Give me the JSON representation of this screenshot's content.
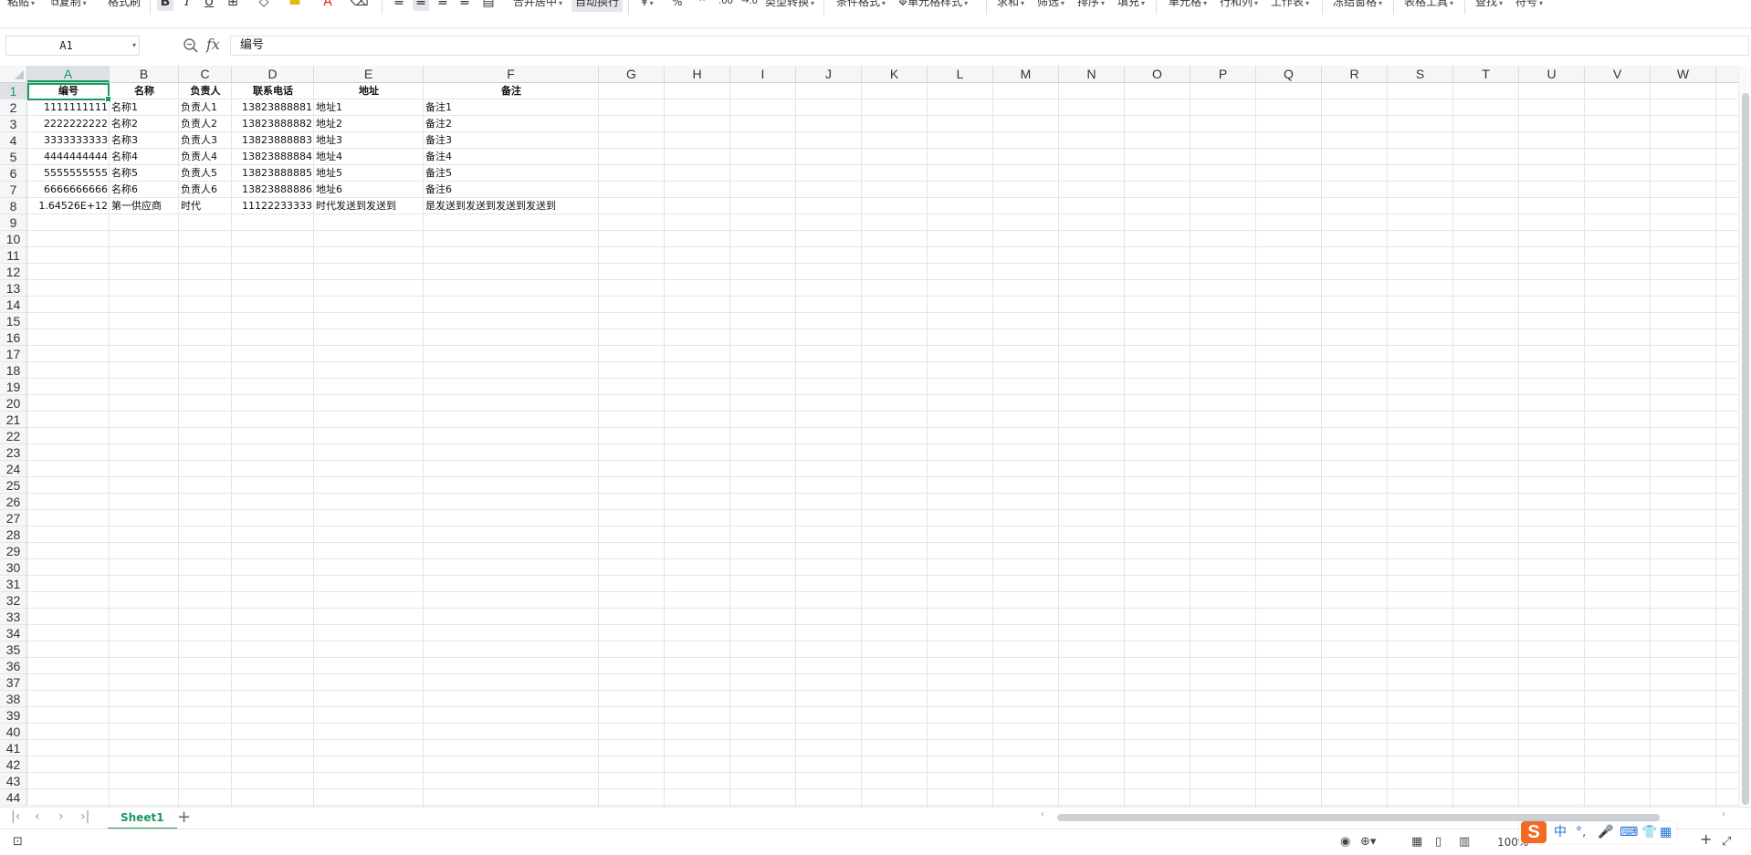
{
  "ribbon": {
    "paste": "粘贴",
    "copy": "复制",
    "format_painter": "格式刷",
    "merge_center": "合并居中",
    "wrap_text": "自动换行",
    "currency": "¥",
    "percent": "%",
    "type_convert": "类型转换",
    "conditional_format": "条件格式",
    "cell_style": "单元格样式",
    "sum": "求和",
    "filter": "筛选",
    "sort": "排序",
    "fill": "填充",
    "cell": "单元格",
    "row_col": "行和列",
    "worksheet": "工作表",
    "freeze": "冻结窗格",
    "table_tools": "表格工具",
    "find": "查找",
    "symbol": "符号"
  },
  "formula_bar": {
    "name_box": "A1",
    "fx": "fx",
    "content": "编号"
  },
  "columns": [
    "A",
    "B",
    "C",
    "D",
    "E",
    "F",
    "G",
    "H",
    "I",
    "J",
    "K",
    "L",
    "M",
    "N",
    "O",
    "P",
    "Q",
    "R",
    "S",
    "T",
    "U",
    "V",
    "W"
  ],
  "rows_visible": 44,
  "header_row": [
    "编号",
    "名称",
    "负责人",
    "联系电话",
    "地址",
    "备注"
  ],
  "data_rows": [
    [
      "1111111111",
      "名称1",
      "负责人1",
      "13823888881",
      "地址1",
      "备注1"
    ],
    [
      "2222222222",
      "名称2",
      "负责人2",
      "13823888882",
      "地址2",
      "备注2"
    ],
    [
      "3333333333",
      "名称3",
      "负责人3",
      "13823888883",
      "地址3",
      "备注3"
    ],
    [
      "4444444444",
      "名称4",
      "负责人4",
      "13823888884",
      "地址4",
      "备注4"
    ],
    [
      "5555555555",
      "名称5",
      "负责人5",
      "13823888885",
      "地址5",
      "备注5"
    ],
    [
      "6666666666",
      "名称6",
      "负责人6",
      "13823888886",
      "地址6",
      "备注6"
    ],
    [
      "1.64526E+12",
      "第一供应商",
      "时代",
      "11122233333",
      "时代发送到发送到",
      "是发送到发送到发送到发送到"
    ]
  ],
  "sheet_tabs": [
    "Sheet1"
  ],
  "status": {
    "zoom": "100%",
    "ime_label": "中"
  },
  "colors": {
    "accent": "#1b9a5f",
    "ime": "#f36b22"
  }
}
